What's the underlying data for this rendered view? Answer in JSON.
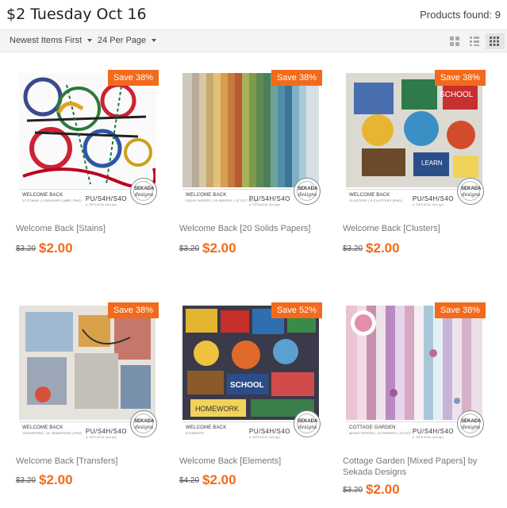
{
  "header": {
    "title": "$2 Tuesday Oct 16",
    "products_found": "Products found: 9"
  },
  "toolbar": {
    "sort_label": "Newest Items First",
    "per_page_label": "24 Per Page",
    "view_icons": [
      "grid-small-icon",
      "list-icon",
      "grid-large-icon"
    ]
  },
  "colors": {
    "accent": "#f26a1b",
    "toolbar_bg": "#f4f4f4"
  },
  "products": [
    {
      "name": "Welcome Back [Stains]",
      "old_price": "$3.20",
      "price": "$2.00",
      "save": "Save 38%",
      "caption": "WELCOME BACK",
      "caption_sub": "12 STAINS | 6 BRUSHES (ABR, PNG)",
      "brand": "PU/S4H/S4O",
      "brand_sub": "a SEKADA design"
    },
    {
      "name": "Welcome Back [20 Solids Papers]",
      "old_price": "$3.20",
      "price": "$2.00",
      "save": "Save 38%",
      "caption": "WELCOME BACK",
      "caption_sub": "SOLID PAPERS | 20 PAPERS | 12\"X12\" (JPG)",
      "brand": "PU/S4H/S4O",
      "brand_sub": "a SEKADA design"
    },
    {
      "name": "Welcome Back [Clusters]",
      "old_price": "$3.20",
      "price": "$2.00",
      "save": "Save 38%",
      "caption": "WELCOME BACK",
      "caption_sub": "CLUSTERS | 8 CLUSTERS (PNG)",
      "brand": "PU/S4H/S4O",
      "brand_sub": "a SEKADA design"
    },
    {
      "name": "Welcome Back [Transfers]",
      "old_price": "$3.20",
      "price": "$2.00",
      "save": "Save 38%",
      "caption": "WELCOME BACK",
      "caption_sub": "TRANSFERS | 16 TRANSFERS (PNG)",
      "brand": "PU/S4H/S4O",
      "brand_sub": "a SEKADA design"
    },
    {
      "name": "Welcome Back [Elements]",
      "old_price": "$4.20",
      "price": "$2.00",
      "save": "Save 52%",
      "caption": "WELCOME BACK",
      "caption_sub": "ELEMENTS",
      "brand": "PU/S4H/S4O",
      "brand_sub": "a SEKADA design"
    },
    {
      "name": "Cottage Garden [Mixed Papers] by Sekada Designs",
      "old_price": "$3.20",
      "price": "$2.00",
      "save": "Save 38%",
      "caption": "COTTAGE GARDEN",
      "caption_sub": "MIXED PAPERS | 20 PAPERS | 12\"X12\"",
      "brand": "PU/S4H/S4O",
      "brand_sub": "a SEKADA design"
    }
  ],
  "seal": {
    "line1": "SEKADA",
    "line2": "designs"
  }
}
